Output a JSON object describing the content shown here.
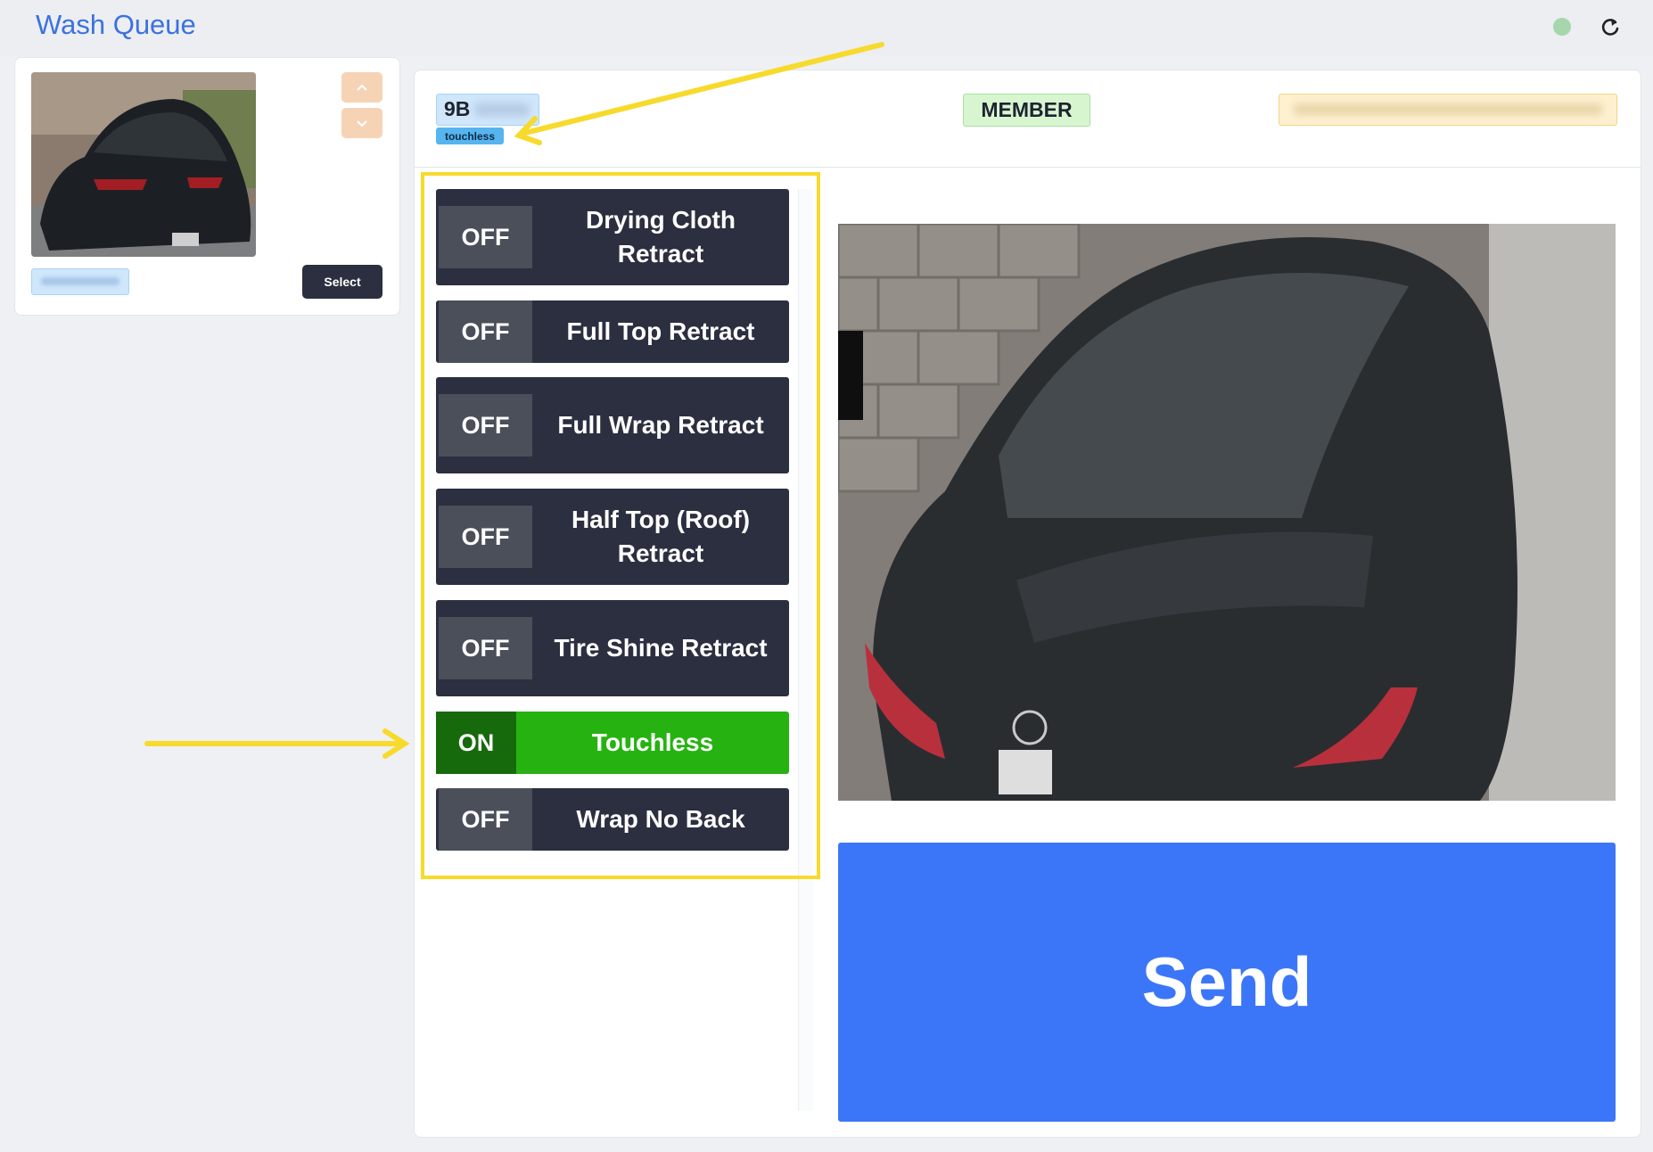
{
  "app": {
    "title": "Wash Queue"
  },
  "queue": {
    "items": [
      {
        "select_label": "Select"
      }
    ]
  },
  "vehicle": {
    "plate_prefix": "9B",
    "package_tag": "touchless",
    "member_badge": "MEMBER"
  },
  "options": [
    {
      "state": "OFF",
      "label": "Drying Cloth Retract",
      "on": false
    },
    {
      "state": "OFF",
      "label": "Full Top Retract",
      "on": false
    },
    {
      "state": "OFF",
      "label": "Full Wrap Retract",
      "on": false
    },
    {
      "state": "OFF",
      "label": "Half Top (Roof) Retract",
      "on": false
    },
    {
      "state": "OFF",
      "label": "Tire Shine Retract",
      "on": false
    },
    {
      "state": "ON",
      "label": "Touchless",
      "on": true
    },
    {
      "state": "OFF",
      "label": "Wrap No Back",
      "on": false
    }
  ],
  "actions": {
    "send_label": "Send"
  },
  "icons": {
    "status": "status-dot-icon",
    "refresh": "refresh-icon",
    "up": "chevron-up-icon",
    "down": "chevron-down-icon"
  },
  "colors": {
    "accent": "#3c76f8",
    "option_off": "#2b2f3f",
    "option_on": "#26b311",
    "annotation": "#f7da2c"
  }
}
